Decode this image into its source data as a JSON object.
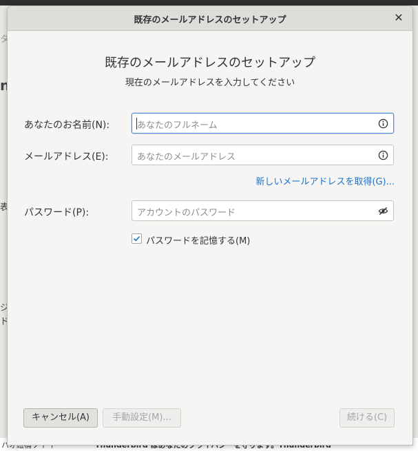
{
  "dialog": {
    "window_title": "既存のメールアドレスのセットアップ",
    "heading": "既存のメールアドレスのセットアップ",
    "subheading": "現在のメールアドレスを入力してください"
  },
  "form": {
    "name_label": "あなたのお名前(N):",
    "name_placeholder": "あなたのフルネーム",
    "email_label": "メールアドレス(E):",
    "email_placeholder": "あなたのメールアドレス",
    "new_email_link": "新しいメールアドレスを取得(G)...",
    "password_label": "パスワード(P):",
    "password_placeholder": "アカウントのパスワード",
    "remember_password_label": "パスワードを記憶する(M)",
    "remember_password_checked": true
  },
  "buttons": {
    "cancel": "キャンセル(A)",
    "manual": "手動設定(M)...",
    "continue": "続ける(C)"
  },
  "background": {
    "footer_left": "ハオ紐桶ソイ ト",
    "footer_right": "Thunderbird はあなたのプライバシーを守ります。Thunderbird"
  },
  "icons": {
    "close": "close-icon",
    "info": "info-icon",
    "eye": "eye-slash-icon",
    "check": "check-icon"
  },
  "colors": {
    "accent": "#1a73c9",
    "focus": "#4a90d9"
  }
}
